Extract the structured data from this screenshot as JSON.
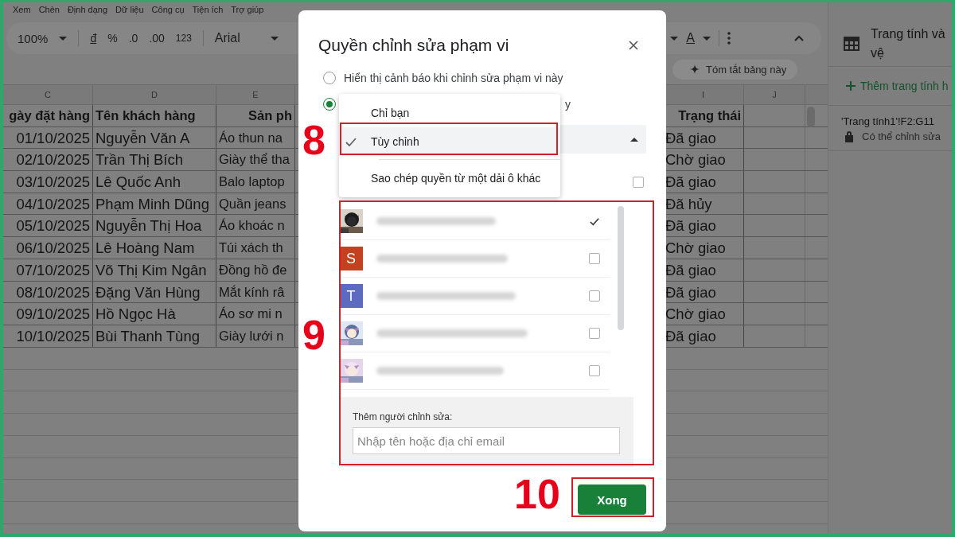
{
  "menu_bar": [
    "Xem",
    "Chèn",
    "Định dạng",
    "Dữ liệu",
    "Công cụ",
    "Tiện ích",
    "Trợ giúp"
  ],
  "toolbar": {
    "zoom": "100%",
    "formats": [
      "đ",
      "%",
      ".0",
      ".00",
      "123"
    ],
    "font": "Arial",
    "text_color_label": "A"
  },
  "summary_chip": "Tóm tắt bảng này",
  "sheet": {
    "columns": [
      "C",
      "D",
      "E",
      "I",
      "J"
    ],
    "header": [
      "gày đặt hàng",
      "Tên khách hàng",
      "Sản ph",
      "Trạng thái"
    ],
    "rows": [
      {
        "date": "01/10/2025",
        "customer": "Nguyễn Văn A",
        "product": "Áo thun na",
        "status": "Đã giao"
      },
      {
        "date": "02/10/2025",
        "customer": "Trần Thị Bích",
        "product": "Giày thể tha",
        "status": "Chờ giao"
      },
      {
        "date": "03/10/2025",
        "customer": "Lê Quốc Anh",
        "product": "Balo laptop",
        "status": "Đã giao"
      },
      {
        "date": "04/10/2025",
        "customer": "Phạm Minh Dũng",
        "product": "Quần jeans",
        "status": "Đã hủy"
      },
      {
        "date": "05/10/2025",
        "customer": "Nguyễn Thị Hoa",
        "product": "Áo khoác n",
        "status": "Đã giao"
      },
      {
        "date": "06/10/2025",
        "customer": "Lê Hoàng Nam",
        "product": "Túi xách th",
        "status": "Chờ giao"
      },
      {
        "date": "07/10/2025",
        "customer": "Võ Thị Kim Ngân",
        "product": "Đồng hồ đe",
        "status": "Đã giao"
      },
      {
        "date": "08/10/2025",
        "customer": "Đặng Văn Hùng",
        "product": "Mắt kính râ",
        "status": "Đã giao"
      },
      {
        "date": "09/10/2025",
        "customer": "Hồ Ngọc Hà",
        "product": "Áo sơ mi n",
        "status": "Chờ giao"
      },
      {
        "date": "10/10/2025",
        "customer": "Bùi Thanh Tùng",
        "product": "Giày lưới n",
        "status": "Đã giao"
      }
    ]
  },
  "side_panel": {
    "title_lines": [
      "Trang tính và",
      "vệ"
    ],
    "add_link": "Thêm trang tính h",
    "ranges": [
      {
        "range": "'Trang tính1'!F2:G11",
        "permission": "Có thể chỉnh sửa"
      }
    ]
  },
  "dialog": {
    "title": "Quyền chỉnh sửa phạm vi",
    "options": [
      {
        "label": "Hiển thị cảnh báo khi chỉnh sửa phạm vi này",
        "selected": false
      },
      {
        "label": "y",
        "selected": true
      }
    ],
    "dropdown_menu": [
      {
        "label": "Chỉ bạn",
        "selected": false,
        "divider_before": false
      },
      {
        "label": "Tùy chỉnh",
        "selected": true,
        "divider_before": false
      },
      {
        "label": "Sao chép quyền từ một dải ô khác",
        "selected": false,
        "divider_before": true
      }
    ],
    "copy_checkbox": {
      "checked": false
    },
    "editors": [
      {
        "kind": "picture",
        "checked": true
      },
      {
        "kind": "letter",
        "letter": "S",
        "color": "#c4401e",
        "checked": false
      },
      {
        "kind": "letter",
        "letter": "T",
        "color": "#5c6bc0",
        "checked": false
      },
      {
        "kind": "picture",
        "checked": false
      },
      {
        "kind": "picture",
        "checked": false
      }
    ],
    "add_editor_label": "Thêm người chỉnh sửa:",
    "add_editor_placeholder": "Nhập tên hoặc địa chỉ email",
    "done_button": "Xong"
  },
  "annotations": [
    {
      "label": "8"
    },
    {
      "label": "9"
    },
    {
      "label": "10"
    }
  ]
}
